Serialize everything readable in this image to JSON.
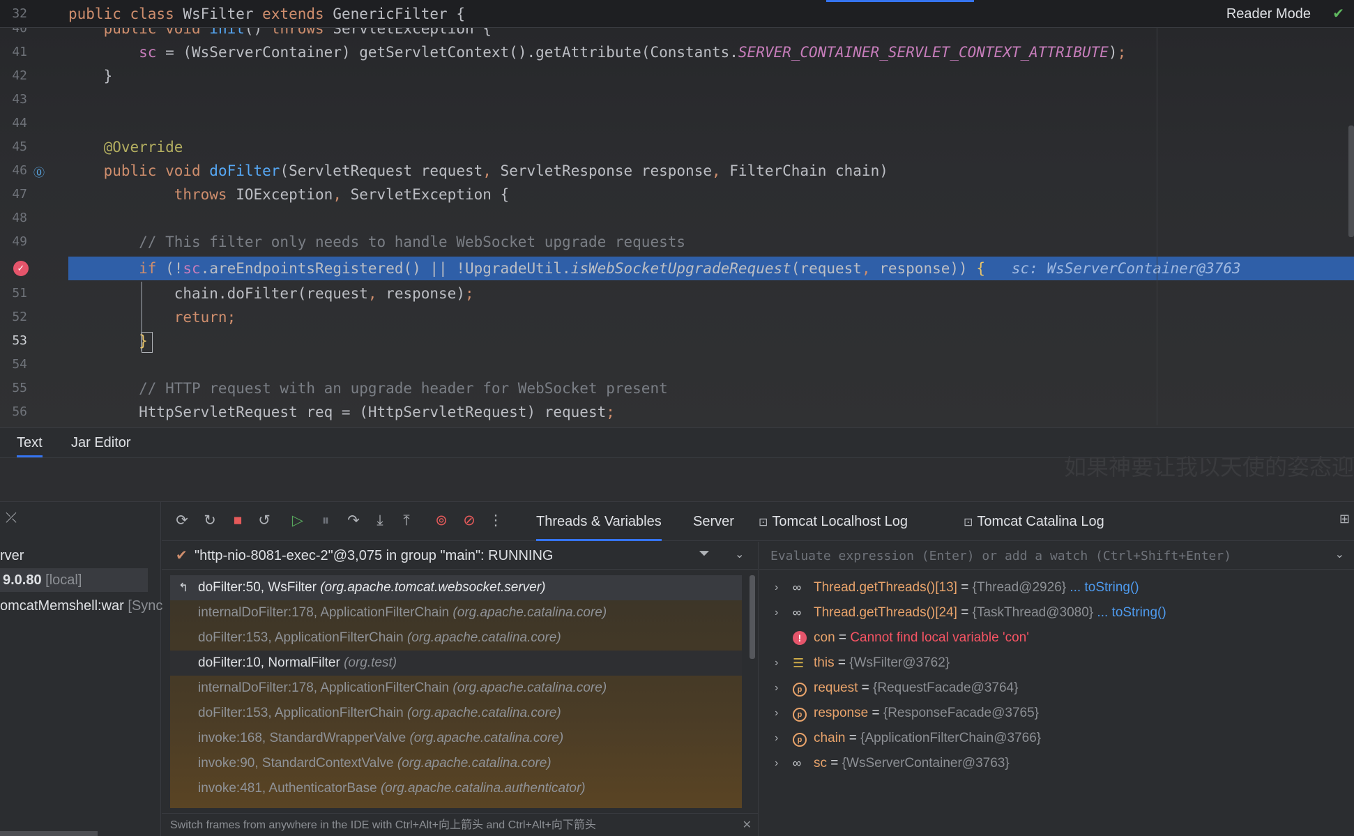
{
  "editor": {
    "sticky": {
      "line_no": "32",
      "line_partial": "40"
    },
    "lines": [
      {
        "no": "41"
      },
      {
        "no": "42"
      },
      {
        "no": "43"
      },
      {
        "no": "44"
      },
      {
        "no": "45"
      },
      {
        "no": "46"
      },
      {
        "no": "47"
      },
      {
        "no": "48"
      },
      {
        "no": "49"
      },
      {
        "no": "51"
      },
      {
        "no": "52"
      },
      {
        "no": "53"
      },
      {
        "no": "54"
      },
      {
        "no": "55"
      },
      {
        "no": "56"
      }
    ],
    "reader_mode": "Reader Mode",
    "inline_hint": "sc: WsServerContainer@3763",
    "tabs": [
      "Text",
      "Jar Editor"
    ]
  },
  "watermark": "如果神要让我以天使的姿态迎",
  "services": {
    "row1": "rver",
    "row2_main": "9.0.80",
    "row2_muted": "[local]",
    "row3_main": "omcatMemshell:war",
    "row3_muted": "[Sync"
  },
  "debug": {
    "tabs": [
      "Threads & Variables",
      "Server",
      "Tomcat Localhost Log",
      "Tomcat Catalina Log"
    ],
    "thread": "\"http-nio-8081-exec-2\"@3,075 in group \"main\": RUNNING",
    "frames": [
      {
        "method": "doFilter:50, WsFilter",
        "pkg": "(org.apache.tomcat.websocket.server)"
      },
      {
        "method": "internalDoFilter:178, ApplicationFilterChain",
        "pkg": "(org.apache.catalina.core)"
      },
      {
        "method": "doFilter:153, ApplicationFilterChain",
        "pkg": "(org.apache.catalina.core)"
      },
      {
        "method": "doFilter:10, NormalFilter",
        "pkg": "(org.test)"
      },
      {
        "method": "internalDoFilter:178, ApplicationFilterChain",
        "pkg": "(org.apache.catalina.core)"
      },
      {
        "method": "doFilter:153, ApplicationFilterChain",
        "pkg": "(org.apache.catalina.core)"
      },
      {
        "method": "invoke:168, StandardWrapperValve",
        "pkg": "(org.apache.catalina.core)"
      },
      {
        "method": "invoke:90, StandardContextValve",
        "pkg": "(org.apache.catalina.core)"
      },
      {
        "method": "invoke:481, AuthenticatorBase",
        "pkg": "(org.apache.catalina.authenticator)"
      }
    ],
    "hint": "Switch frames from anywhere in the IDE with Ctrl+Alt+向上箭头 and Ctrl+Alt+向下箭头",
    "eval_placeholder": "Evaluate expression (Enter) or add a watch (Ctrl+Shift+Enter)",
    "vars": [
      {
        "name": "Thread.getThreads()[13]",
        "value": "{Thread@2926}",
        "link": "... toString()"
      },
      {
        "name": "Thread.getThreads()[24]",
        "value": "{TaskThread@3080}",
        "link": "... toString()"
      },
      {
        "name": "con",
        "error": "Cannot find local variable 'con'"
      },
      {
        "name": "this",
        "value": "{WsFilter@3762}"
      },
      {
        "name": "request",
        "value": "{RequestFacade@3764}"
      },
      {
        "name": "response",
        "value": "{ResponseFacade@3765}"
      },
      {
        "name": "chain",
        "value": "{ApplicationFilterChain@3766}"
      },
      {
        "name": "sc",
        "value": "{WsServerContainer@3763}"
      }
    ],
    "equals": "="
  },
  "colors": {
    "accent": "#3574f0",
    "exec_line": "#2f5fa8",
    "keyword": "#cf8e6d",
    "error": "#f75464",
    "link": "#4e9bef"
  }
}
